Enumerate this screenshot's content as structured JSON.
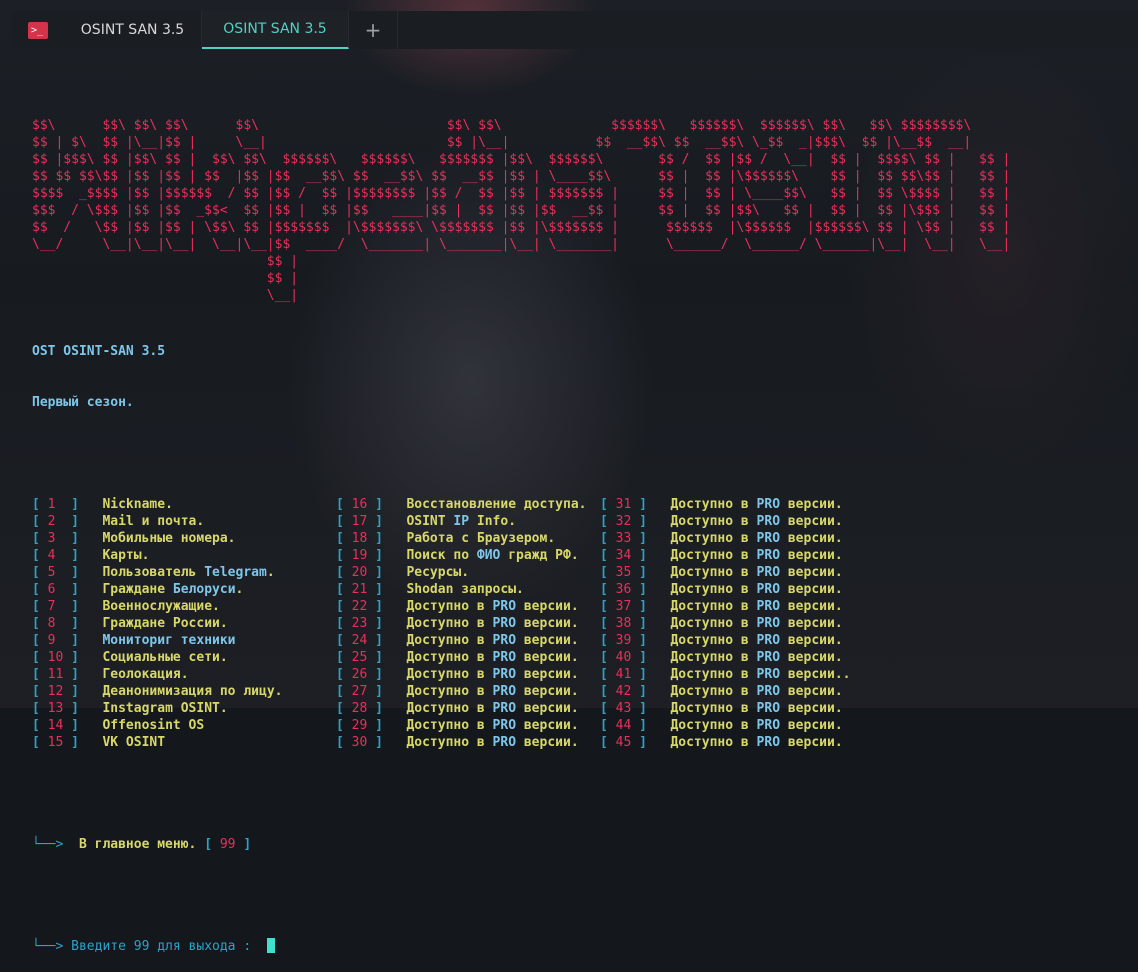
{
  "window": {
    "tabs": [
      {
        "label": "OSINT SAN 3.5",
        "active": false
      },
      {
        "label": "OSINT SAN 3.5",
        "active": true
      }
    ],
    "add_tab_label": "+"
  },
  "banner": [
    "$$\\      $$\\ $$\\ $$\\      $$\\                        $$\\ $$\\              $$$$$$\\   $$$$$$\\  $$$$$$\\ $$\\   $$\\ $$$$$$$$\\",
    "$$ | $\\  $$ |\\__|$$ |     \\__|                       $$ |\\__|           $$  __$$\\ $$  __$$\\ \\_$$  _|$$$\\  $$ |\\__$$  __|",
    "$$ |$$$\\ $$ |$$\\ $$ |  $$\\ $$\\  $$$$$$\\   $$$$$$\\   $$$$$$$ |$$\\  $$$$$$\\       $$ /  $$ |$$ /  \\__|  $$ |  $$$$\\ $$ |   $$ |",
    "$$ $$ $$\\$$ |$$ |$$ | $$  |$$ |$$  __$$\\ $$  __$$\\ $$  __$$ |$$ | \\____$$\\      $$ |  $$ |\\$$$$$$\\    $$ |  $$ $$\\$$ |   $$ |",
    "$$$$  _$$$$ |$$ |$$$$$$  / $$ |$$ /  $$ |$$$$$$$$ |$$ /  $$ |$$ | $$$$$$$ |     $$ |  $$ | \\____$$\\   $$ |  $$ \\$$$$ |   $$ |",
    "$$$  / \\$$$ |$$ |$$  _$$<  $$ |$$ |  $$ |$$   ____|$$ |  $$ |$$ |$$  __$$ |     $$ |  $$ |$$\\   $$ |  $$ |  $$ |\\$$$ |   $$ |",
    "$$  /   \\$$ |$$ |$$ | \\$$\\ $$ |$$$$$$$  |\\$$$$$$$\\ \\$$$$$$$ |$$ |\\$$$$$$$ |      $$$$$$  |\\$$$$$$  |$$$$$$\\ $$ | \\$$ |   $$ |",
    "\\__/     \\__|\\__|\\__|  \\__|\\__|$$  ____/  \\_______| \\_______|\\__| \\_______|      \\______/  \\______/ \\______|\\__|  \\__|   \\__|",
    "                              $$ |",
    "                              $$ |",
    "                              \\__|"
  ],
  "heading": {
    "line1": "OST OSINT-SAN 3.5",
    "line2": "Первый сезон."
  },
  "menu": {
    "col1": [
      {
        "n": "1",
        "label": "Nickname."
      },
      {
        "n": "2",
        "label": "Mail и почта."
      },
      {
        "n": "3",
        "label": "Мобильные номера."
      },
      {
        "n": "4",
        "label": "Карты."
      },
      {
        "n": "5",
        "label": "Пользователь ",
        "hl": "Telegram",
        "tail": "."
      },
      {
        "n": "6",
        "label": "Граждане ",
        "hl": "Белоруси",
        "tail": "."
      },
      {
        "n": "7",
        "label": "Военнослужащие."
      },
      {
        "n": "8",
        "label": "Граждане России."
      },
      {
        "n": "9",
        "label": "",
        "hl": "Мониториг техники",
        "tail": ""
      },
      {
        "n": "10",
        "label": "Социальные сети."
      },
      {
        "n": "11",
        "label": "Геолокация."
      },
      {
        "n": "12",
        "label": "Деанонимизация по лицу."
      },
      {
        "n": "13",
        "label": "Instagram OSINT."
      },
      {
        "n": "14",
        "label": "Offenosint OS"
      },
      {
        "n": "15",
        "label": "VK OSINT"
      }
    ],
    "col2": [
      {
        "n": "16",
        "label": "Восстановление доступа."
      },
      {
        "n": "17",
        "label": "OSINT ",
        "hl": "IP",
        "tail": " Info."
      },
      {
        "n": "18",
        "label": "Работа с Браузером."
      },
      {
        "n": "19",
        "label": "Поиск по ",
        "hl": "ФИО",
        "tail": " гражд РФ."
      },
      {
        "n": "20",
        "label": "Ресурсы."
      },
      {
        "n": "21",
        "label": "Shodan запросы."
      },
      {
        "n": "22",
        "label": "Доступно в ",
        "hl": "PRO",
        "tail": " версии."
      },
      {
        "n": "23",
        "label": "Доступно в ",
        "hl": "PRO",
        "tail": " версии."
      },
      {
        "n": "24",
        "label": "Доступно в ",
        "hl": "PRO",
        "tail": " версии."
      },
      {
        "n": "25",
        "label": "Доступно в ",
        "hl": "PRO",
        "tail": " версии."
      },
      {
        "n": "26",
        "label": "Доступно в ",
        "hl": "PRO",
        "tail": " версии."
      },
      {
        "n": "27",
        "label": "Доступно в ",
        "hl": "PRO",
        "tail": " версии."
      },
      {
        "n": "28",
        "label": "Доступно в ",
        "hl": "PRO",
        "tail": " версии."
      },
      {
        "n": "29",
        "label": "Доступно в ",
        "hl": "PRO",
        "tail": " версии."
      },
      {
        "n": "30",
        "label": "Доступно в ",
        "hl": "PRO",
        "tail": " версии."
      }
    ],
    "col3": [
      {
        "n": "31",
        "label": "Доступно в ",
        "hl": "PRO",
        "tail": " версии."
      },
      {
        "n": "32",
        "label": "Доступно в ",
        "hl": "PRO",
        "tail": " версии."
      },
      {
        "n": "33",
        "label": "Доступно в ",
        "hl": "PRO",
        "tail": " версии."
      },
      {
        "n": "34",
        "label": "Доступно в ",
        "hl": "PRO",
        "tail": " версии."
      },
      {
        "n": "35",
        "label": "Доступно в ",
        "hl": "PRO",
        "tail": " версии."
      },
      {
        "n": "36",
        "label": "Доступно в ",
        "hl": "PRO",
        "tail": " версии."
      },
      {
        "n": "37",
        "label": "Доступно в ",
        "hl": "PRO",
        "tail": " версии."
      },
      {
        "n": "38",
        "label": "Доступно в ",
        "hl": "PRO",
        "tail": " версии."
      },
      {
        "n": "39",
        "label": "Доступно в ",
        "hl": "PRO",
        "tail": " версии."
      },
      {
        "n": "40",
        "label": "Доступно в ",
        "hl": "PRO",
        "tail": " версии."
      },
      {
        "n": "41",
        "label": "Доступно в ",
        "hl": "PRO",
        "tail": " версии.."
      },
      {
        "n": "42",
        "label": "Доступно в ",
        "hl": "PRO",
        "tail": " версии."
      },
      {
        "n": "43",
        "label": "Доступно в ",
        "hl": "PRO",
        "tail": " версии."
      },
      {
        "n": "44",
        "label": "Доступно в ",
        "hl": "PRO",
        "tail": " версии."
      },
      {
        "n": "45",
        "label": "Доступно в ",
        "hl": "PRO",
        "tail": " версии."
      }
    ]
  },
  "main_menu": {
    "arrow": "└──>",
    "label": "В главное меню.",
    "num": "99"
  },
  "prompt": {
    "arrow": "└──>",
    "text": "Введите 99 для выхода :"
  }
}
